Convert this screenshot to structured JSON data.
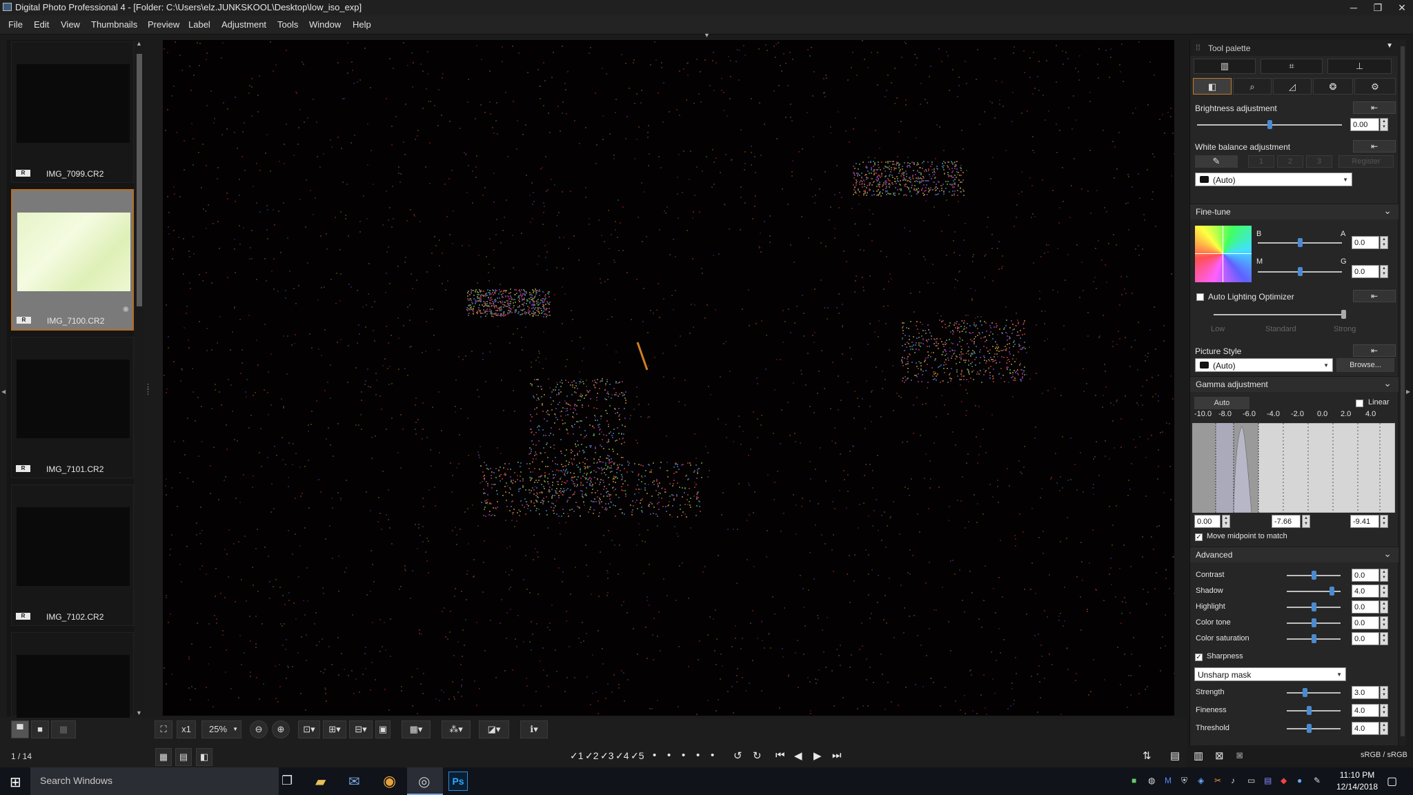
{
  "window": {
    "title": "Digital Photo Professional 4 - [Folder: C:\\Users\\elz.JUNKSKOOL\\Desktop\\low_iso_exp]",
    "minimize": "─",
    "restore": "❐",
    "close": "✕"
  },
  "menu": [
    "File",
    "Edit",
    "View",
    "Thumbnails",
    "Preview",
    "Label",
    "Adjustment",
    "Tools",
    "Window",
    "Help"
  ],
  "filmstrip": {
    "thumbnails": [
      {
        "name": "IMG_7099.CR2",
        "badge": "R",
        "selected": false
      },
      {
        "name": "IMG_7100.CR2",
        "badge": "R",
        "selected": true
      },
      {
        "name": "IMG_7101.CR2",
        "badge": "R",
        "selected": false
      },
      {
        "name": "IMG_7102.CR2",
        "badge": "R",
        "selected": false
      },
      {
        "name": "",
        "badge": "",
        "selected": false
      }
    ],
    "counter": "1 / 14"
  },
  "toolbar": {
    "zoom": "25%",
    "x1": "x1",
    "rating_marks": [
      "✓1",
      "✓2",
      "✓3",
      "✓4",
      "✓5"
    ],
    "color_space": "sRGB / sRGB"
  },
  "palette": {
    "title": "Tool palette",
    "brightness": {
      "label": "Brightness adjustment",
      "value": "0.00"
    },
    "white_balance": {
      "label": "White balance adjustment",
      "presets": [
        "1",
        "2",
        "3"
      ],
      "register": "Register",
      "mode": "(Auto)"
    },
    "fine_tune": {
      "label": "Fine-tune",
      "b": "B",
      "a": "A",
      "m": "M",
      "g": "G",
      "ba_value": "0.0",
      "mg_value": "0.0"
    },
    "alo": {
      "label": "Auto Lighting Optimizer",
      "low": "Low",
      "standard": "Standard",
      "strong": "Strong"
    },
    "picture_style": {
      "label": "Picture Style",
      "value": "(Auto)",
      "browse": "Browse..."
    },
    "gamma": {
      "label": "Gamma adjustment",
      "auto": "Auto",
      "linear": "Linear",
      "scale": [
        "-10.0",
        "-8.0",
        "-6.0",
        "-4.0",
        "-2.0",
        "0.0",
        "2.0",
        "4.0"
      ],
      "black": "0.00",
      "mid": "-7.66",
      "white": "-9.41",
      "move_midpoint": "Move midpoint to match"
    },
    "advanced": {
      "label": "Advanced",
      "rows": [
        {
          "label": "Contrast",
          "value": "0.0"
        },
        {
          "label": "Shadow",
          "value": "4.0"
        },
        {
          "label": "Highlight",
          "value": "0.0"
        },
        {
          "label": "Color tone",
          "value": "0.0"
        },
        {
          "label": "Color saturation",
          "value": "0.0"
        }
      ]
    },
    "sharpness": {
      "label": "Sharpness",
      "mode": "Unsharp mask",
      "rows": [
        {
          "label": "Strength",
          "value": "3.0"
        },
        {
          "label": "Fineness",
          "value": "4.0"
        },
        {
          "label": "Threshold",
          "value": "4.0"
        }
      ]
    }
  },
  "taskbar": {
    "search": "Search Windows",
    "time": "11:10 PM",
    "date": "12/14/2018"
  },
  "colors": {
    "accent": "#b96d1e",
    "slider_knob": "#4a8ad0",
    "taskbar_bg": "#101319"
  }
}
